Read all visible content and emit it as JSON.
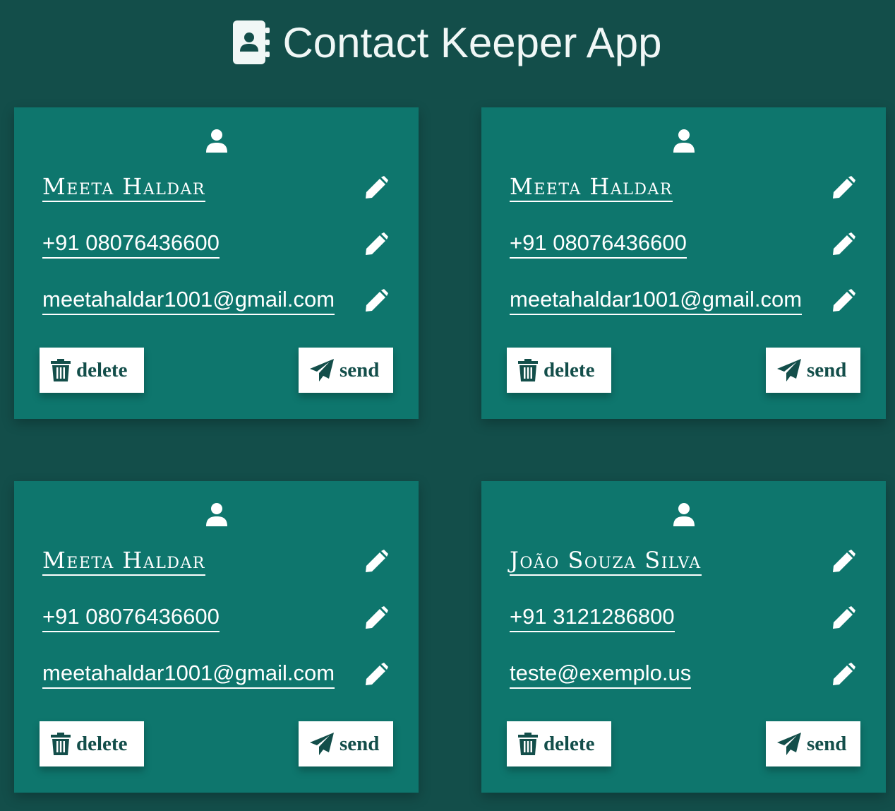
{
  "header": {
    "title": "Contact Keeper App",
    "icon": "address-book-icon"
  },
  "colors": {
    "background": "#134e4a",
    "card": "#0e766d",
    "button_bg": "#ffffff",
    "button_text": "#134e4a",
    "text": "#ffffff"
  },
  "contacts": [
    {
      "name": "Meeta Haldar",
      "phone": "+91 08076436600",
      "email": "meetahaldar1001@gmail.com",
      "delete_label": "delete",
      "send_label": "send"
    },
    {
      "name": "Meeta Haldar",
      "phone": "+91 08076436600",
      "email": "meetahaldar1001@gmail.com",
      "delete_label": "delete",
      "send_label": "send"
    },
    {
      "name": "Meeta Haldar",
      "phone": "+91 08076436600",
      "email": "meetahaldar1001@gmail.com",
      "delete_label": "delete",
      "send_label": "send"
    },
    {
      "name": "João Souza Silva",
      "phone": "+91 3121286800",
      "email": "teste@exemplo.us",
      "delete_label": "delete",
      "send_label": "send"
    }
  ],
  "icons": {
    "avatar": "user-icon",
    "edit": "pencil-icon",
    "delete": "trash-icon",
    "send": "paper-plane-icon"
  }
}
